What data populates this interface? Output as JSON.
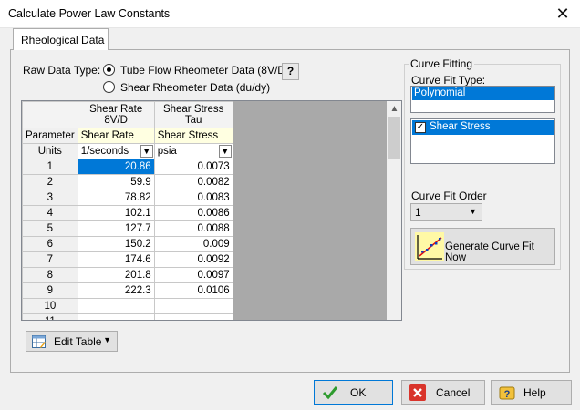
{
  "window": {
    "title": "Calculate Power Law Constants",
    "close_glyph": "✕"
  },
  "tab": {
    "label": "Rheological Data"
  },
  "raw_data": {
    "label": "Raw Data Type:",
    "options": [
      {
        "label": "Tube Flow Rheometer Data (8V/D)",
        "selected": true
      },
      {
        "label": "Shear Rheometer Data (du/dy)",
        "selected": false
      }
    ],
    "help_label": "?"
  },
  "grid": {
    "col1_header": [
      "Shear Rate",
      "8V/D"
    ],
    "col2_header": [
      "Shear Stress",
      "Tau"
    ],
    "param_label": "Parameter",
    "param_values": [
      "Shear Rate",
      "Shear Stress"
    ],
    "units_label": "Units",
    "units_values": [
      "1/seconds",
      "psia"
    ],
    "rows": [
      {
        "n": "1",
        "rate": "20.86",
        "stress": "0.0073"
      },
      {
        "n": "2",
        "rate": "59.9",
        "stress": "0.0082"
      },
      {
        "n": "3",
        "rate": "78.82",
        "stress": "0.0083"
      },
      {
        "n": "4",
        "rate": "102.1",
        "stress": "0.0086"
      },
      {
        "n": "5",
        "rate": "127.7",
        "stress": "0.0088"
      },
      {
        "n": "6",
        "rate": "150.2",
        "stress": "0.009"
      },
      {
        "n": "7",
        "rate": "174.6",
        "stress": "0.0092"
      },
      {
        "n": "8",
        "rate": "201.8",
        "stress": "0.0097"
      },
      {
        "n": "9",
        "rate": "222.3",
        "stress": "0.0106"
      },
      {
        "n": "10",
        "rate": "",
        "stress": ""
      },
      {
        "n": "11",
        "rate": "",
        "stress": ""
      }
    ]
  },
  "edit_table": {
    "label": "Edit Table"
  },
  "curve_fitting": {
    "group_label": "Curve Fitting",
    "type_label": "Curve Fit Type:",
    "type_value": "Polynomial",
    "series": [
      {
        "label": "Shear Stress",
        "checked": true
      }
    ],
    "order_label": "Curve Fit Order",
    "order_value": "1",
    "generate_label": "Generate Curve Fit Now"
  },
  "buttons": {
    "ok": "OK",
    "cancel": "Cancel",
    "help": "Help"
  },
  "colors": {
    "selection": "#0078d7",
    "param_row": "#ffffe1",
    "grid_empty": "#a9a9a9"
  }
}
